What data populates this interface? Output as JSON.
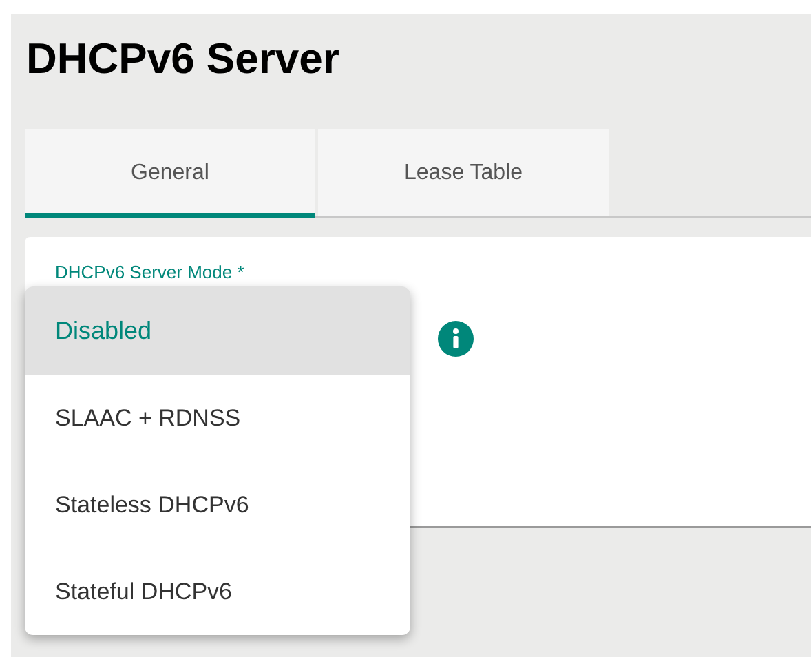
{
  "page": {
    "title": "DHCPv6 Server"
  },
  "tabs": [
    {
      "label": "General",
      "selected": true
    },
    {
      "label": "Lease Table",
      "selected": false
    }
  ],
  "field": {
    "label": "DHCPv6 Server Mode *"
  },
  "menu": [
    {
      "label": "Disabled",
      "selected": true
    },
    {
      "label": "SLAAC + RDNSS",
      "selected": false
    },
    {
      "label": "Stateless DHCPv6",
      "selected": false
    },
    {
      "label": "Stateful DHCPv6",
      "selected": false
    }
  ]
}
